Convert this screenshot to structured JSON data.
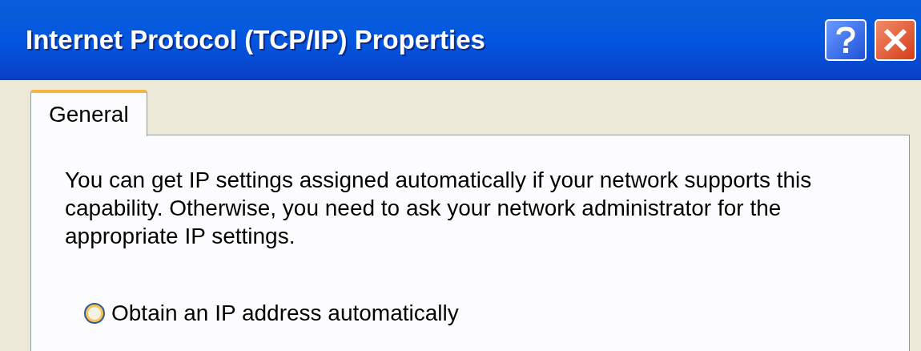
{
  "window": {
    "title": "Internet Protocol (TCP/IP) Properties"
  },
  "tabs": [
    {
      "label": "General",
      "selected": true
    }
  ],
  "description": "You can get IP settings assigned automatically if your network supports this capability. Otherwise, you need to ask your network administrator for the appropriate IP settings.",
  "options": [
    {
      "label": "Obtain an IP address automatically",
      "selected": false
    }
  ]
}
